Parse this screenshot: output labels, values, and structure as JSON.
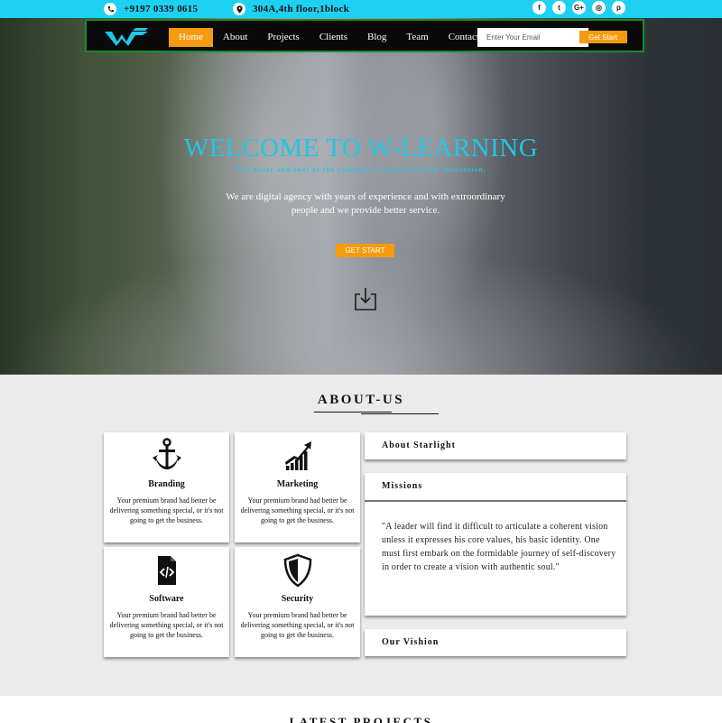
{
  "topbar": {
    "phone": "+9197 0339 0615",
    "address": "304A,4th floor,1block",
    "social": [
      {
        "icon": "facebook-icon",
        "glyph": "f"
      },
      {
        "icon": "twitter-icon",
        "glyph": "t"
      },
      {
        "icon": "google-plus-icon",
        "glyph": "G+"
      },
      {
        "icon": "instagram-icon",
        "glyph": "◎"
      },
      {
        "icon": "pinterest-icon",
        "glyph": "p"
      }
    ]
  },
  "nav": {
    "items": [
      "Home",
      "About",
      "Projects",
      "Clients",
      "Blog",
      "Team",
      "Contact"
    ],
    "active": "Home",
    "email_placeholder": "Enter Your Email",
    "cta": "Get Start"
  },
  "hero": {
    "title": "WELCOME TO W-LEARNING",
    "subtitle": "The heart and soul of the company is creativity and innovation.",
    "description": "We are digital agency with years of experience and with extroordinary people and we provide better service.",
    "button": "GET START"
  },
  "about": {
    "title": "ABOUT-US",
    "cards": [
      {
        "title": "Branding",
        "icon": "anchor-icon",
        "text": "Your premium brand had better be delivering something special, or it's not going to get the business."
      },
      {
        "title": "Marketing",
        "icon": "growth-chart-icon",
        "text": "Your premium brand had better be delivering something special, or it's not going to get the business."
      },
      {
        "title": "Software",
        "icon": "code-file-icon",
        "text": "Your premium brand had better be delivering something special, or it's not going to get the business."
      },
      {
        "title": "Security",
        "icon": "shield-icon",
        "text": "Your premium brand had better be delivering something special, or it's not going to get the business."
      }
    ],
    "accordion": [
      {
        "title": "About Starlight"
      },
      {
        "title": "Missions",
        "body": "\"A leader will find it difficult to articulate a coherent vision unless it expresses his core values, his basic identity. One must first embark on the formidable journey of self-discovery in order to create a vision with authentic soul.\""
      },
      {
        "title": "Our Vishion"
      }
    ]
  },
  "latest": {
    "title": "LATEST PROJECTS"
  },
  "colors": {
    "accent": "#1ed0f2",
    "orange": "#f59b0e",
    "nav": "#0a0a0a"
  }
}
